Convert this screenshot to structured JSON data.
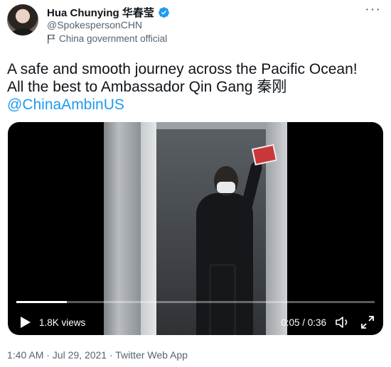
{
  "author": {
    "name": "Hua Chunying 华春莹",
    "handle": "@SpokespersonCHN",
    "label": "China government official",
    "verified_color": "#1d9bf0"
  },
  "tweet": {
    "line1": "A safe and smooth journey across the Pacific Ocean!",
    "line2": "All the best to Ambassador Qin Gang 秦刚",
    "mention": "@ChinaAmbinUS"
  },
  "video": {
    "views": "1.8K views",
    "time": "0:05 / 0:36",
    "progress": 0.14
  },
  "meta": {
    "timestamp": "1:40 AM · Jul 29, 2021 · Twitter Web App"
  },
  "icons": {
    "more": "more-icon",
    "verified": "verified-badge-icon",
    "flag": "flag-icon",
    "play": "play-icon",
    "volume": "volume-icon",
    "expand": "expand-icon"
  }
}
